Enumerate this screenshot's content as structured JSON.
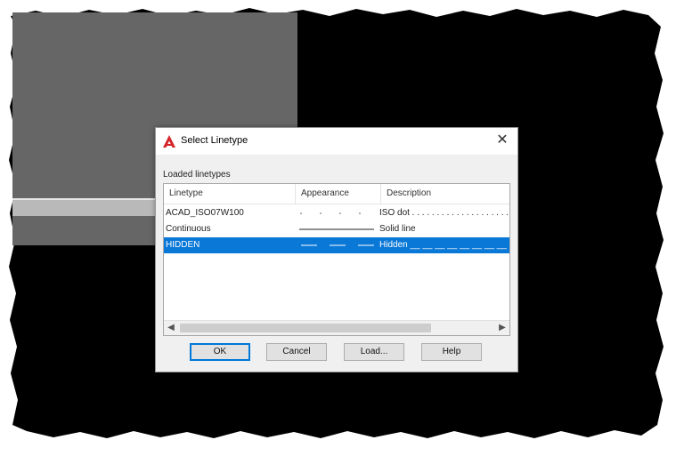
{
  "dialog": {
    "title": "Select Linetype",
    "close_icon": "close-icon",
    "app_icon": "autocad-logo-icon",
    "group_label": "Loaded linetypes",
    "columns": [
      "Linetype",
      "Appearance",
      "Description"
    ],
    "rows": [
      {
        "linetype": "ACAD_ISO07W100",
        "appearance": "dot-pattern",
        "description": "ISO dot . . . . . . . . . . . . . . . . . . . .",
        "selected": false
      },
      {
        "linetype": "Continuous",
        "appearance": "solid-pattern",
        "description": "Solid line",
        "selected": false
      },
      {
        "linetype": "HIDDEN",
        "appearance": "dash-pattern",
        "description": "Hidden __ __ __ __ __ __ __ __",
        "selected": true
      }
    ],
    "buttons": {
      "ok": "OK",
      "cancel": "Cancel",
      "load": "Load...",
      "help": "Help"
    },
    "scroll_left_icon": "scroll-left-icon",
    "scroll_right_icon": "scroll-right-icon"
  },
  "colors": {
    "selection": "#0a78d7",
    "viewport_background": "#000000",
    "viewport_panel": "#666666",
    "brand_red": "#d4262a"
  }
}
